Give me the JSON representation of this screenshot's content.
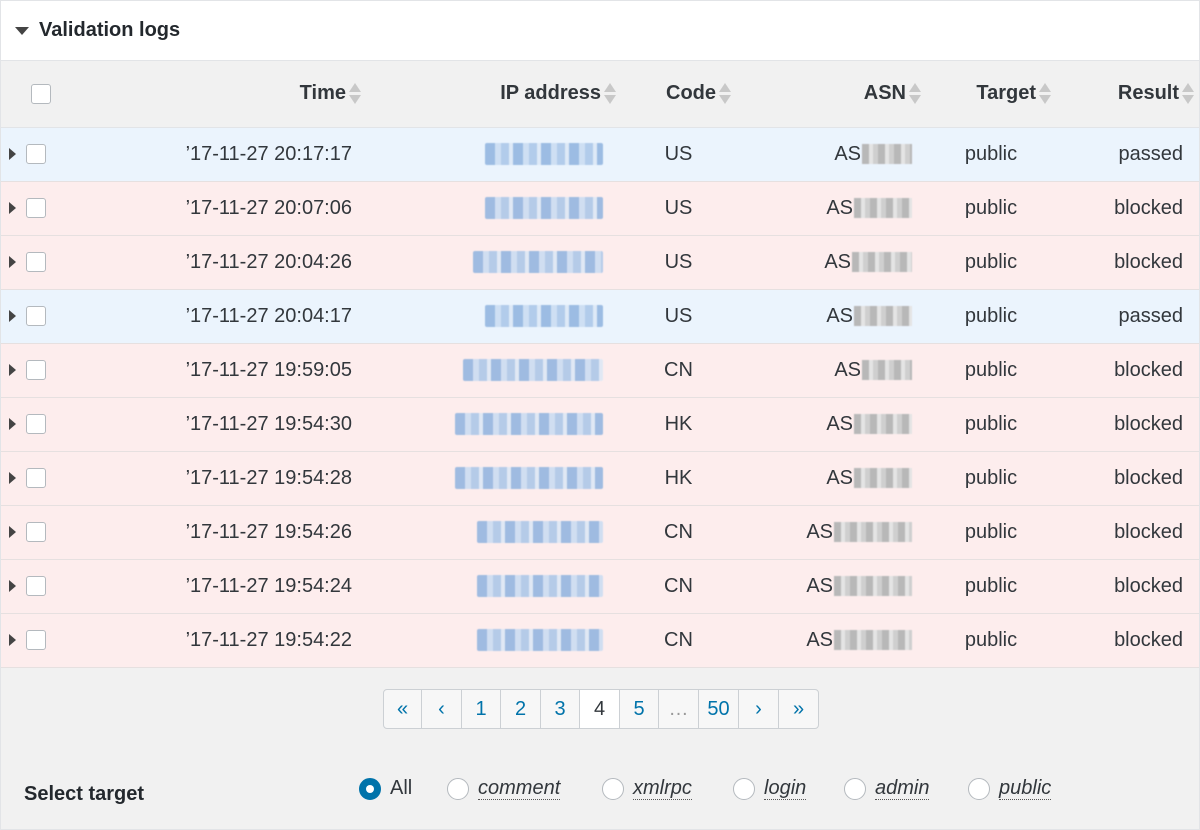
{
  "panel": {
    "title": "Validation logs"
  },
  "table": {
    "columns": [
      "Time",
      "IP address",
      "Code",
      "ASN",
      "Target",
      "Result"
    ],
    "rows": [
      {
        "time": "’17-11-27 20:17:17",
        "code": "US",
        "asn_prefix": "AS",
        "target": "public",
        "result": "passed"
      },
      {
        "time": "’17-11-27 20:07:06",
        "code": "US",
        "asn_prefix": "AS",
        "target": "public",
        "result": "blocked"
      },
      {
        "time": "’17-11-27 20:04:26",
        "code": "US",
        "asn_prefix": "AS",
        "target": "public",
        "result": "blocked"
      },
      {
        "time": "’17-11-27 20:04:17",
        "code": "US",
        "asn_prefix": "AS",
        "target": "public",
        "result": "passed"
      },
      {
        "time": "’17-11-27 19:59:05",
        "code": "CN",
        "asn_prefix": "AS",
        "target": "public",
        "result": "blocked"
      },
      {
        "time": "’17-11-27 19:54:30",
        "code": "HK",
        "asn_prefix": "AS",
        "target": "public",
        "result": "blocked"
      },
      {
        "time": "’17-11-27 19:54:28",
        "code": "HK",
        "asn_prefix": "AS",
        "target": "public",
        "result": "blocked"
      },
      {
        "time": "’17-11-27 19:54:26",
        "code": "CN",
        "asn_prefix": "AS",
        "target": "public",
        "result": "blocked"
      },
      {
        "time": "’17-11-27 19:54:24",
        "code": "CN",
        "asn_prefix": "AS",
        "target": "public",
        "result": "blocked"
      },
      {
        "time": "’17-11-27 19:54:22",
        "code": "CN",
        "asn_prefix": "AS",
        "target": "public",
        "result": "blocked"
      }
    ]
  },
  "pagination": {
    "first": "«",
    "prev": "‹",
    "pages": [
      "1",
      "2",
      "3",
      "4",
      "5"
    ],
    "current": "4",
    "ellipsis": "…",
    "last_page": "50",
    "next": "›",
    "last": "»"
  },
  "select_target": {
    "label": "Select target",
    "options": [
      "All",
      "comment",
      "xmlrpc",
      "login",
      "admin",
      "public"
    ],
    "selected": "All"
  },
  "colors": {
    "passed_row": "#ebf4fd",
    "blocked_row": "#fdeded",
    "link": "#0073aa"
  },
  "icons": {
    "panel_toggle": "triangle-down-icon",
    "row_expand": "triangle-right-icon",
    "sort": "sort-arrows-icon"
  }
}
